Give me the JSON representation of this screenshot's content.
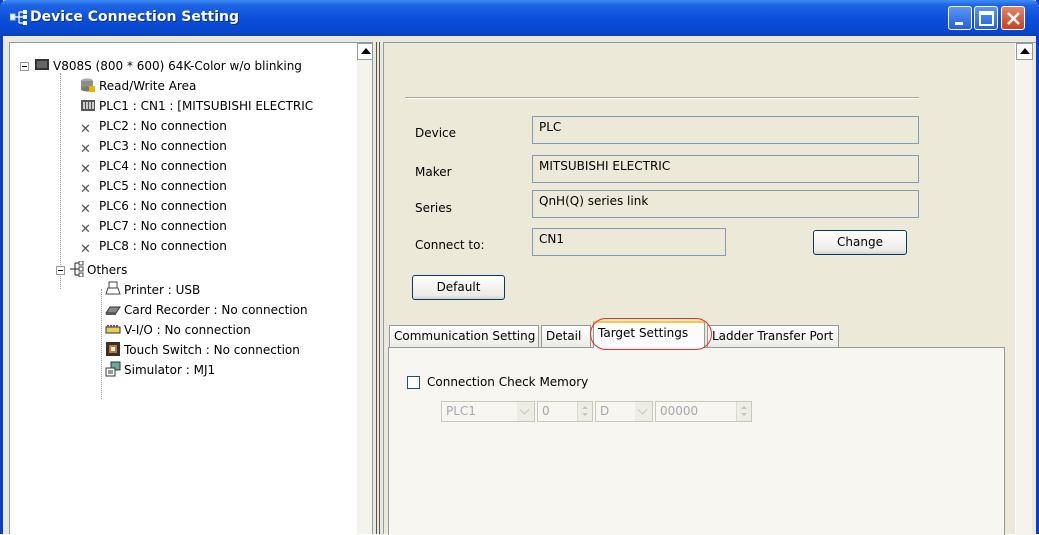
{
  "window": {
    "title": "Device Connection Setting"
  },
  "tree": {
    "root_label": "V808S (800 * 600) 64K-Color w/o blinking",
    "items": [
      {
        "label": "Read/Write Area",
        "icon": "database-icon"
      },
      {
        "label": "PLC1 : CN1 : [MITSUBISHI ELECTRIC",
        "icon": "plc-icon"
      },
      {
        "label": "PLC2 : No connection",
        "icon": "x-icon"
      },
      {
        "label": "PLC3 : No connection",
        "icon": "x-icon"
      },
      {
        "label": "PLC4 : No connection",
        "icon": "x-icon"
      },
      {
        "label": "PLC5 : No connection",
        "icon": "x-icon"
      },
      {
        "label": "PLC6 : No connection",
        "icon": "x-icon"
      },
      {
        "label": "PLC7 : No connection",
        "icon": "x-icon"
      },
      {
        "label": "PLC8 : No connection",
        "icon": "x-icon"
      }
    ],
    "others_label": "Others",
    "others_items": [
      {
        "label": "Printer : USB",
        "icon": "printer-icon"
      },
      {
        "label": "Card Recorder : No connection",
        "icon": "card-recorder-icon"
      },
      {
        "label": "V-I/O : No connection",
        "icon": "vio-icon"
      },
      {
        "label": "Touch Switch : No connection",
        "icon": "touch-switch-icon"
      },
      {
        "label": "Simulator : MJ1",
        "icon": "simulator-icon"
      }
    ]
  },
  "device_panel": {
    "device_label": "Device",
    "device_value": "PLC",
    "maker_label": "Maker",
    "maker_value": "MITSUBISHI ELECTRIC",
    "series_label": "Series",
    "series_value": "QnH(Q) series link",
    "connect_label": "Connect to:",
    "connect_value": "CN1",
    "change_button": "Change",
    "default_button": "Default"
  },
  "tabs": [
    {
      "label": "Communication Setting",
      "active": false
    },
    {
      "label": "Detail",
      "active": false
    },
    {
      "label": "Target Settings",
      "active": true
    },
    {
      "label": "Ladder Transfer Port",
      "active": false
    }
  ],
  "target_settings": {
    "check_label": "Connection Check Memory",
    "checked": false,
    "plc_select": "PLC1",
    "number_value": "0",
    "device_select": "D",
    "address_value": "00000"
  },
  "colors": {
    "titlebar": "#0A4FDA",
    "highlight_ring": "#E03030",
    "tab_accent": "#FFC83C"
  }
}
